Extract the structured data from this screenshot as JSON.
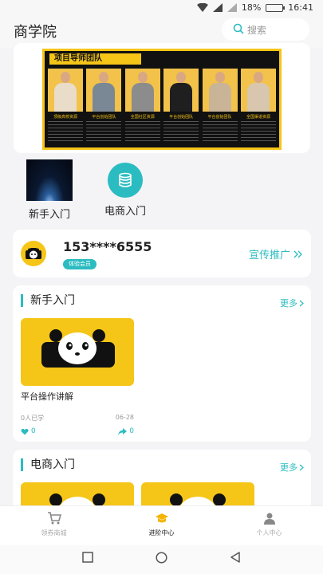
{
  "status": {
    "battery": "18%",
    "time": "16:41",
    "battery_level": 0.18
  },
  "header": {
    "title": "商学院",
    "search_placeholder": "搜索"
  },
  "banner": {
    "title": "项目导师团队",
    "mentor_roles": [
      "顶级高校资源",
      "平台创始团队",
      "全国社区资源",
      "平台创始团队",
      "平台创始团队",
      "全国渠道资源"
    ]
  },
  "categories": [
    {
      "label": "新手入门",
      "icon": "earth-horizon-image"
    },
    {
      "label": "电商入门",
      "icon": "database-icon"
    }
  ],
  "user": {
    "phone": "153****6555",
    "badge": "体验会员",
    "promo": "宣传推广"
  },
  "sections": [
    {
      "title": "新手入门",
      "more": "更多",
      "courses": [
        {
          "name": "平台操作讲解",
          "learners": "0人已学",
          "date": "06-28",
          "likes": "0",
          "shares": "0"
        }
      ]
    },
    {
      "title": "电商入门",
      "more": "更多"
    }
  ],
  "tabs": [
    {
      "label": "领券商城",
      "icon": "cart-icon",
      "active": false
    },
    {
      "label": "进阶中心",
      "icon": "graduation-cap-icon",
      "active": true
    },
    {
      "label": "个人中心",
      "icon": "person-icon",
      "active": false
    }
  ],
  "colors": {
    "accent": "#2bbcc1",
    "brand_yellow": "#f5c518"
  }
}
